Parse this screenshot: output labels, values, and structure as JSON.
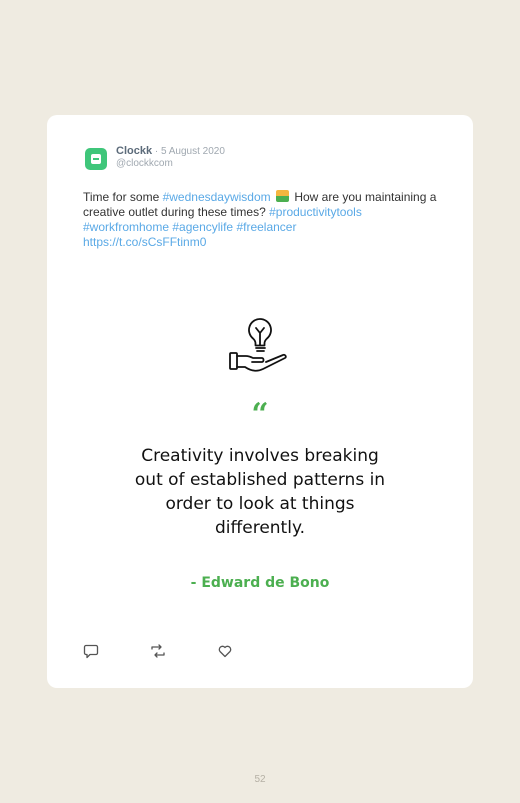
{
  "tweet": {
    "author_name": "Clockk",
    "date": " · 5 August 2020",
    "handle": "@clockkcom",
    "text_1": "Time for some ",
    "hashtag_1": "#wednesdaywisdom",
    "text_2": " How are you maintaining a creative outlet during these times? ",
    "hashtag_2": "#productivitytools",
    "hashtag_3": "#workfromhome",
    "hashtag_4": "#agencylife",
    "hashtag_5": "#freelancer",
    "link": "https://t.co/sCsFFtinm0",
    "emoji": "sunrise-emoji",
    "colors": {
      "accent": "#4caf50",
      "link": "#5aa9e6",
      "avatar": "#3fc67a"
    }
  },
  "quote": {
    "mark": "“",
    "text": "Creativity involves breaking out of established patterns in order to look at things differently.",
    "author": "- Edward de Bono",
    "icon": "lightbulb-hand-icon"
  },
  "actions": {
    "reply_icon": "reply-icon",
    "retweet_icon": "retweet-icon",
    "like_icon": "heart-icon"
  },
  "page": {
    "number": "52"
  }
}
